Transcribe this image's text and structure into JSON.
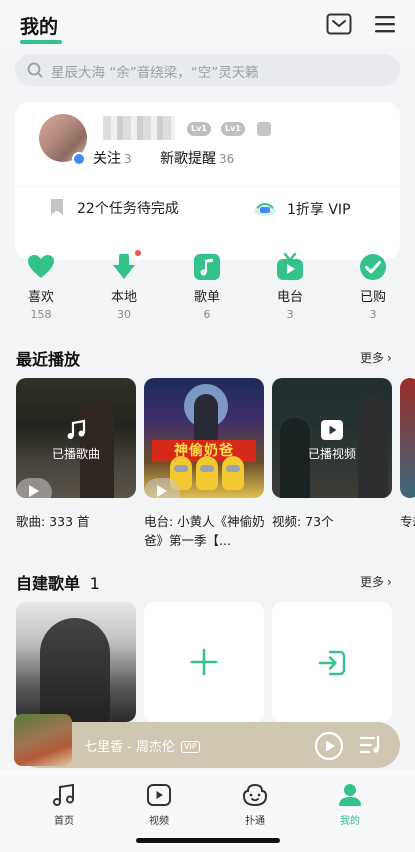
{
  "header": {
    "title": "我的"
  },
  "search": {
    "placeholder": "星辰大海 “余”音绕梁，“空”灵天籁"
  },
  "profile": {
    "level_badges": [
      "Lv1",
      "Lv1"
    ],
    "follow_label": "关注",
    "follow_count": "3",
    "newsong_label": "新歌提醒",
    "newsong_count": "36",
    "tasks_text": "22个任务待完成",
    "vip_text": "1折享 VIP"
  },
  "quick": [
    {
      "label": "喜欢",
      "count": "158",
      "icon": "heart-icon"
    },
    {
      "label": "本地",
      "count": "30",
      "icon": "download-icon"
    },
    {
      "label": "歌单",
      "count": "6",
      "icon": "music-note-icon"
    },
    {
      "label": "电台",
      "count": "3",
      "icon": "radio-icon"
    },
    {
      "label": "已购",
      "count": "3",
      "icon": "check-circle-icon"
    }
  ],
  "recent": {
    "title": "最近播放",
    "more": "更多",
    "cards": [
      {
        "overlay": "已播歌曲",
        "caption": "歌曲: 333 首"
      },
      {
        "poster_title": "神偷奶爸",
        "caption": "电台: 小黄人《神偷奶爸》第一季【..."
      },
      {
        "overlay": "已播视频",
        "caption": "视频: 73个"
      },
      {
        "caption": "专劫"
      }
    ]
  },
  "playlists": {
    "title": "自建歌单",
    "count": "1",
    "more": "更多"
  },
  "player": {
    "song": "七里香 - 周杰伦",
    "vip": "VIP"
  },
  "tabs": [
    {
      "label": "首页",
      "icon": "music-note-icon"
    },
    {
      "label": "视频",
      "icon": "video-icon"
    },
    {
      "label": "扑通",
      "icon": "face-icon"
    },
    {
      "label": "我的",
      "icon": "person-icon",
      "active": true
    }
  ],
  "colors": {
    "accent": "#33c38a",
    "red_dot": "#f25353"
  }
}
